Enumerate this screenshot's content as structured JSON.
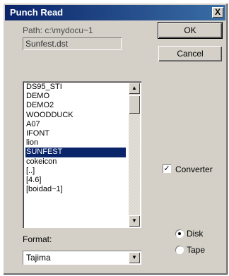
{
  "window": {
    "title": "Punch Read",
    "close_glyph": "X"
  },
  "path": {
    "label": "Path:  c:\\mydocu~1",
    "value": "Sunfest.dst"
  },
  "buttons": {
    "ok": "OK",
    "cancel": "Cancel"
  },
  "file_list": {
    "items": [
      "DS95_STI",
      "DEMO",
      "DEMO2",
      "WOODDUCK",
      "A07",
      "IFONT",
      "lion",
      "SUNFEST",
      "cokeicon",
      "[..]",
      "[4.6]",
      "[boidad~1]"
    ],
    "selected": "SUNFEST"
  },
  "format": {
    "label": "Format:",
    "value": "Tajima"
  },
  "converter": {
    "label": "Converter",
    "checked": true
  },
  "source": {
    "options": [
      {
        "label": "Disk",
        "selected": true
      },
      {
        "label": "Tape",
        "selected": false
      }
    ]
  },
  "icons": {
    "close": "close-icon",
    "scroll_up": "arrow-up-icon",
    "scroll_down": "arrow-down-icon",
    "dropdown": "chevron-down-icon",
    "check": "check-icon"
  }
}
